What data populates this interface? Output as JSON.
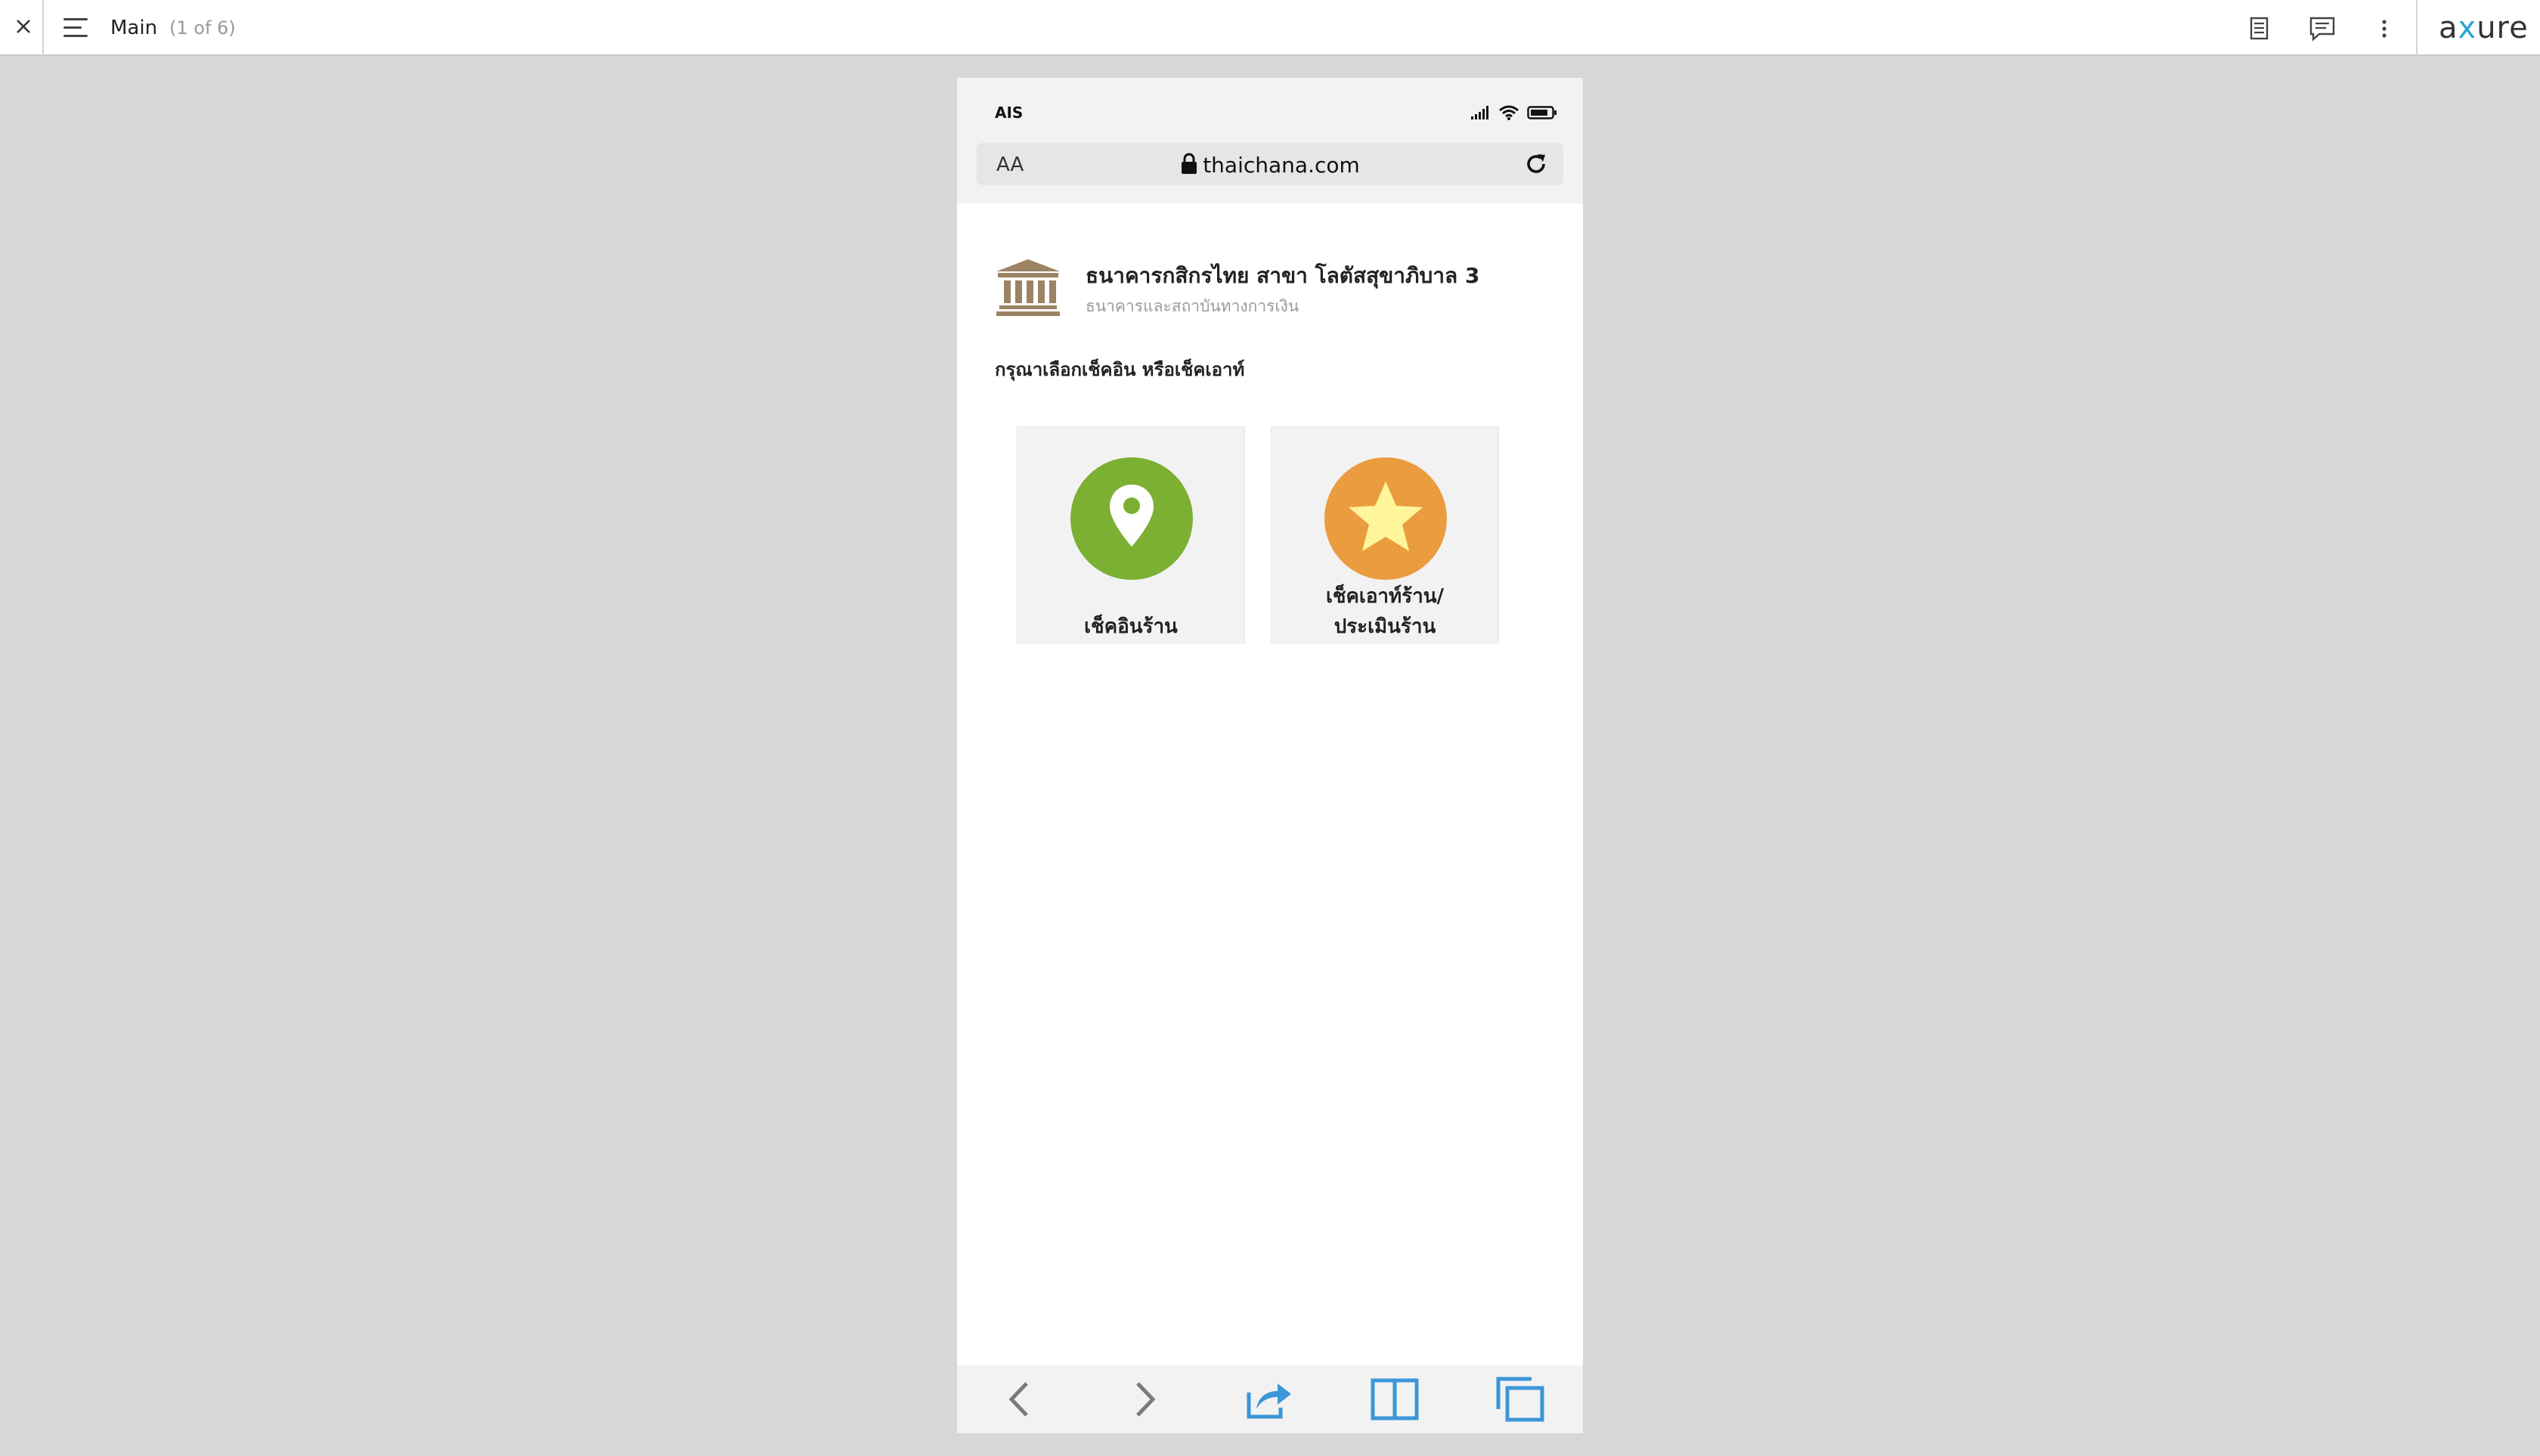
{
  "viewer": {
    "page_name": "Main",
    "page_count": "(1 of 6)",
    "brand": "axure",
    "icons": [
      "close-icon",
      "menu-icon",
      "notes-icon",
      "comments-icon",
      "more-icon"
    ]
  },
  "phone": {
    "carrier": "AIS",
    "url": "thaichana.com",
    "text_size_label": "AA",
    "shop": {
      "name": "ธนาคารกสิกรไทย สาขา โลตัสสุขาภิบาล 3",
      "category": "ธนาคารและสถาบันทางการเงิน"
    },
    "prompt": "กรุณาเลือกเช็คอิน หรือเช็คเอาท์",
    "checkin": {
      "label": "เช็คอินร้าน"
    },
    "checkout": {
      "label_line1": "เช็คเอาท์ร้าน/",
      "label_line2": "ประเมินร้าน"
    }
  },
  "colors": {
    "checkin_green": "#7cb032",
    "checkout_orange": "#ea9c3e",
    "star_yellow": "#fff59a",
    "toolbar_blue": "#3a97d8",
    "bank_icon_brown": "#9b8364"
  }
}
